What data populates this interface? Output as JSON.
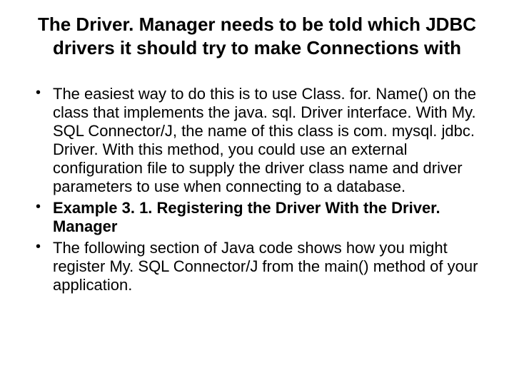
{
  "title": "The Driver. Manager needs to be told which JDBC drivers it should try to make Connections with",
  "bullets": [
    {
      "text": "The easiest way to do this is to use Class. for. Name() on the class that implements the java. sql. Driver interface. With My. SQL Connector/J, the name of this class is com. mysql. jdbc. Driver. With this method, you could use an external configuration file to supply the driver class name and driver parameters to use when connecting to a database.",
      "bold": false
    },
    {
      "text": "Example 3. 1. Registering the Driver With the Driver. Manager",
      "bold": true
    },
    {
      "text": "The following section of Java code shows how you might register My. SQL Connector/J from the main() method of your application.",
      "bold": false
    }
  ]
}
